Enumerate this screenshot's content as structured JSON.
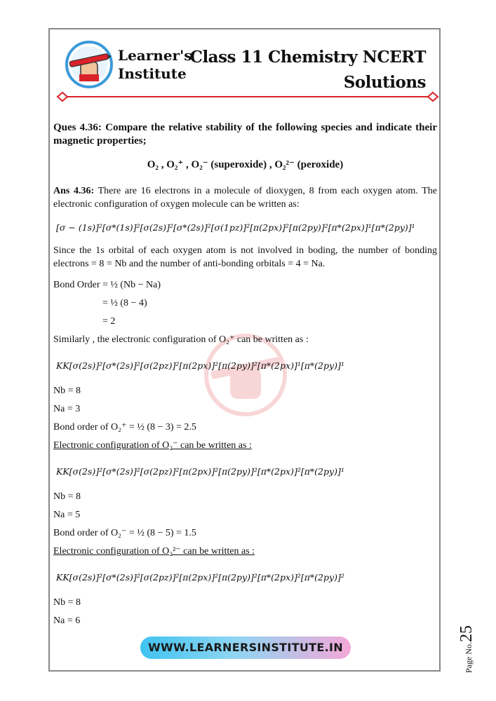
{
  "header": {
    "brand_line1": "Learner's",
    "brand_line2": "Institute",
    "title_line1": "Class 11 Chemistry NCERT",
    "title_line2": "Solutions"
  },
  "question": {
    "text": "Ques 4.36: Compare the relative stability of the following species and indicate their magnetic properties;",
    "species": "O₂ , O₂⁺ , O₂⁻ (superoxide) , O₂²⁻ (peroxide)"
  },
  "answer": {
    "label": "Ans 4.36:",
    "intro": "There are 16 electrons in a molecule of dioxygen, 8 from each oxygen atom. The electronic configuration of oxygen molecule can be written as:",
    "config_o2": "[σ − (1s)]²[σ*(1s)]²[σ(2s)]²[σ*(2s)]²[σ(1pz)]²[π(2px)]²[π(2py)]²[π*(2px)]¹[π*(2py)]¹",
    "since": "Since the 1s orbital of each oxygen atom is not involved in boding, the number of bonding electrons = 8 = Nb and the number of anti-bonding orbitals = 4 = Na.",
    "bo_step1": "Bond Order = ½ (Nb − Na)",
    "bo_step2": "= ½ (8 − 4)",
    "bo_step3": "= 2",
    "similarly": "Similarly , the electronic configuration of O₂⁺ can be written as :",
    "config_o2plus": "KK[σ(2s)]²[σ*(2s)]²[σ(2pz)]²[π(2px)]²[π(2py)]²[π*(2px)]¹[π*(2py)]¹",
    "o2plus_nb": "Nb  = 8",
    "o2plus_na": "Na  = 3",
    "o2plus_bo": "Bond order of O₂⁺ = ½ (8 − 3) = 2.5",
    "o2minus_heading": "Electronic configuration of O₂⁻ can be written as :",
    "config_o2minus": "KK[σ(2s)]²[σ*(2s)]²[σ(2pz)]²[π(2px)]²[π(2py)]²[π*(2px)]²[π*(2py)]¹",
    "o2minus_nb": "Nb  = 8",
    "o2minus_na": "Na  = 5",
    "o2minus_bo": "Bond order of O₂⁻ = ½ (8 − 5) = 1.5",
    "o22minus_heading": "Electronic configuration of O₂²⁻ can be written as :",
    "config_o22minus": "KK[σ(2s)]²[σ*(2s)]²[σ(2pz)]²[π(2px)]²[π(2py)]²[π*(2px)]²[π*(2py)]²",
    "o22minus_nb": "Nb  = 8",
    "o22minus_na": "Na  = 6"
  },
  "footer": {
    "website": "WWW.LEARNERSINSTITUTE.IN",
    "page_label": "Page No.",
    "page_number": "25"
  },
  "colors": {
    "divider": "#d9222a",
    "logo_ring": "#3b9ad9",
    "website_left": "#3fc3f0",
    "website_right": "#f4a8d8"
  }
}
